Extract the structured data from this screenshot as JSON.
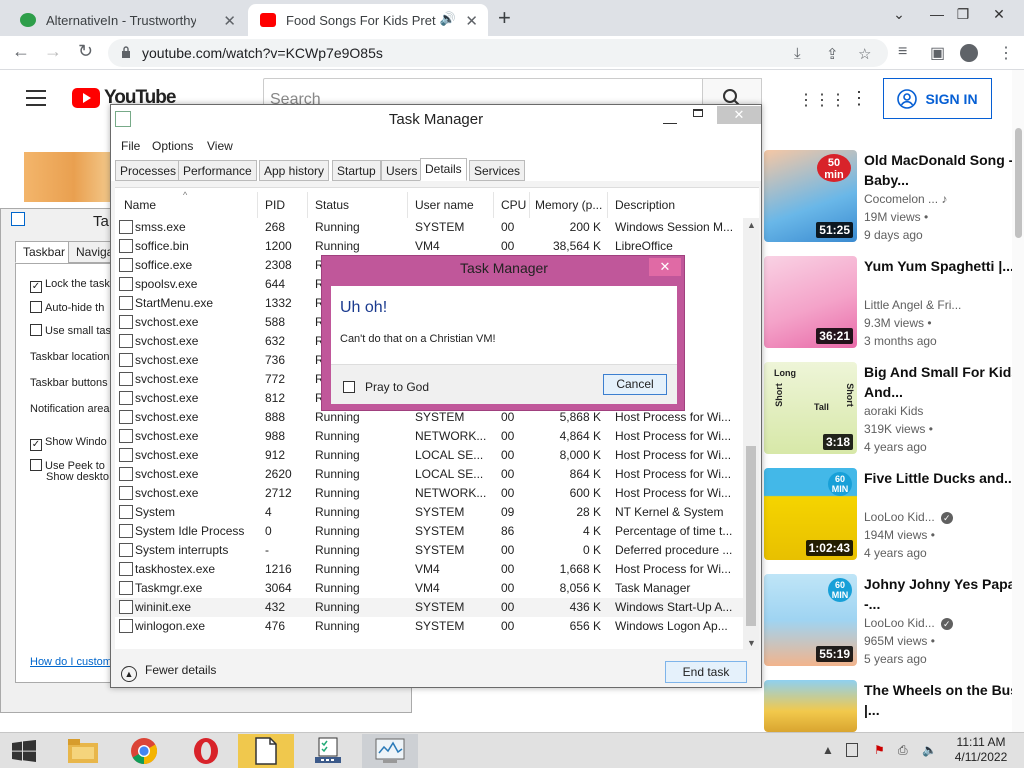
{
  "browser": {
    "tabs": [
      {
        "title": "AlternativeIn - Trustworthy Software",
        "favicon_color": "#2e9e4a"
      },
      {
        "title": "Food Songs For Kids Pretend",
        "favicon_color": "#ff0000"
      }
    ],
    "url": "youtube.com/watch?v=KCWp7e9O85s"
  },
  "youtube": {
    "logo_text": "YouTube",
    "search_placeholder": "Search",
    "signin_label": "SIGN IN",
    "recommendations": [
      {
        "title": "Old MacDonald Song - Baby...",
        "channel": "Cocomelon ...",
        "views": "19M views •",
        "age": "9 days ago",
        "duration": "51:25",
        "badge": "50 min",
        "thumb_color": "#69b7e8"
      },
      {
        "title": "Yum Yum Spaghetti |...",
        "channel": "Little Angel & Fri...",
        "views": "9.3M views •",
        "age": "3 months ago",
        "duration": "36:21",
        "thumb_color": "#f4a3c9"
      },
      {
        "title": "Big And Small For Kids And...",
        "channel": "aoraki Kids",
        "views": "319K views •",
        "age": "4 years ago",
        "duration": "3:18",
        "thumb_color": "#e7f0c7",
        "badge_texts": [
          "Long",
          "Short",
          "Tall",
          "Short"
        ]
      },
      {
        "title": "Five Little Ducks and...",
        "channel": "LooLoo Kid...",
        "views": "194M views •",
        "age": "4 years ago",
        "duration": "1:02:43",
        "badge": "60 MIN",
        "thumb_color": "#f5d400"
      },
      {
        "title": "Johny Johny Yes Papa -...",
        "channel": "LooLoo Kid...",
        "views": "965M views •",
        "age": "5 years ago",
        "duration": "55:19",
        "badge": "60 MIN",
        "thumb_color": "#9fd4f2"
      },
      {
        "title": "The Wheels on the Bus |...",
        "thumb_color": "#f2c94c"
      }
    ]
  },
  "taskbar_props": {
    "title": "Ta",
    "tabs": [
      "Taskbar",
      "Naviga"
    ],
    "options": [
      {
        "label": "Lock the task",
        "checked": true
      },
      {
        "label": "Auto-hide th",
        "checked": false
      },
      {
        "label": "Use small tas",
        "checked": false
      }
    ],
    "labels": [
      "Taskbar location",
      "Taskbar buttons",
      "Notification area"
    ],
    "show_windows": {
      "label": "Show Windo",
      "checked": true
    },
    "peek": {
      "label1": "Use Peek to",
      "label2": "Show deskto",
      "checked": false
    },
    "link": "How do I custom"
  },
  "taskmgr": {
    "title": "Task Manager",
    "menu": [
      "File",
      "Options",
      "View"
    ],
    "tabs": [
      "Processes",
      "Performance",
      "App history",
      "Startup",
      "Users",
      "Details",
      "Services"
    ],
    "active_tab": "Details",
    "columns": [
      "Name",
      "PID",
      "Status",
      "User name",
      "CPU",
      "Memory (p...",
      "Description"
    ],
    "rows": [
      [
        "smss.exe",
        "268",
        "Running",
        "SYSTEM",
        "00",
        "200 K",
        "Windows Session M..."
      ],
      [
        "soffice.bin",
        "1200",
        "Running",
        "VM4",
        "00",
        "38,564 K",
        "LibreOffice"
      ],
      [
        "soffice.exe",
        "2308",
        "R",
        "",
        "",
        "",
        ""
      ],
      [
        "spoolsv.exe",
        "644",
        "R",
        "",
        "",
        "",
        "ystem ..."
      ],
      [
        "StartMenu.exe",
        "1332",
        "R",
        "",
        "",
        "",
        "enu"
      ],
      [
        "svchost.exe",
        "588",
        "R",
        "",
        "",
        "",
        "for Wi..."
      ],
      [
        "svchost.exe",
        "632",
        "R",
        "",
        "",
        "",
        "for Wi..."
      ],
      [
        "svchost.exe",
        "736",
        "R",
        "",
        "",
        "",
        "for Wi..."
      ],
      [
        "svchost.exe",
        "772",
        "R",
        "",
        "",
        "",
        "for Wi..."
      ],
      [
        "svchost.exe",
        "812",
        "R",
        "",
        "",
        "",
        "for Wi..."
      ],
      [
        "svchost.exe",
        "888",
        "Running",
        "SYSTEM",
        "00",
        "5,868 K",
        "Host Process for Wi..."
      ],
      [
        "svchost.exe",
        "988",
        "Running",
        "NETWORK...",
        "00",
        "4,864 K",
        "Host Process for Wi..."
      ],
      [
        "svchost.exe",
        "912",
        "Running",
        "LOCAL SE...",
        "00",
        "8,000 K",
        "Host Process for Wi..."
      ],
      [
        "svchost.exe",
        "2620",
        "Running",
        "LOCAL SE...",
        "00",
        "864 K",
        "Host Process for Wi..."
      ],
      [
        "svchost.exe",
        "2712",
        "Running",
        "NETWORK...",
        "00",
        "600 K",
        "Host Process for Wi..."
      ],
      [
        "System",
        "4",
        "Running",
        "SYSTEM",
        "09",
        "28 K",
        "NT Kernel & System"
      ],
      [
        "System Idle Process",
        "0",
        "Running",
        "SYSTEM",
        "86",
        "4 K",
        "Percentage of time t..."
      ],
      [
        "System interrupts",
        "-",
        "Running",
        "SYSTEM",
        "00",
        "0 K",
        "Deferred procedure ..."
      ],
      [
        "taskhostex.exe",
        "1216",
        "Running",
        "VM4",
        "00",
        "1,668 K",
        "Host Process for Wi..."
      ],
      [
        "Taskmgr.exe",
        "3064",
        "Running",
        "VM4",
        "00",
        "8,056 K",
        "Task Manager"
      ],
      [
        "wininit.exe",
        "432",
        "Running",
        "SYSTEM",
        "00",
        "436 K",
        "Windows Start-Up A..."
      ],
      [
        "winlogon.exe",
        "476",
        "Running",
        "SYSTEM",
        "00",
        "656 K",
        "Windows Logon Ap..."
      ]
    ],
    "selected_row": 20,
    "fewer_details": "Fewer details",
    "end_task": "End task"
  },
  "dialog": {
    "title": "Task Manager",
    "heading": "Uh oh!",
    "message": "Can't do that on a Christian VM!",
    "checkbox_label": "Pray to God",
    "checkbox_checked": false,
    "cancel_label": "Cancel"
  },
  "system_tray": {
    "time": "11:11 AM",
    "date": "4/11/2022"
  }
}
